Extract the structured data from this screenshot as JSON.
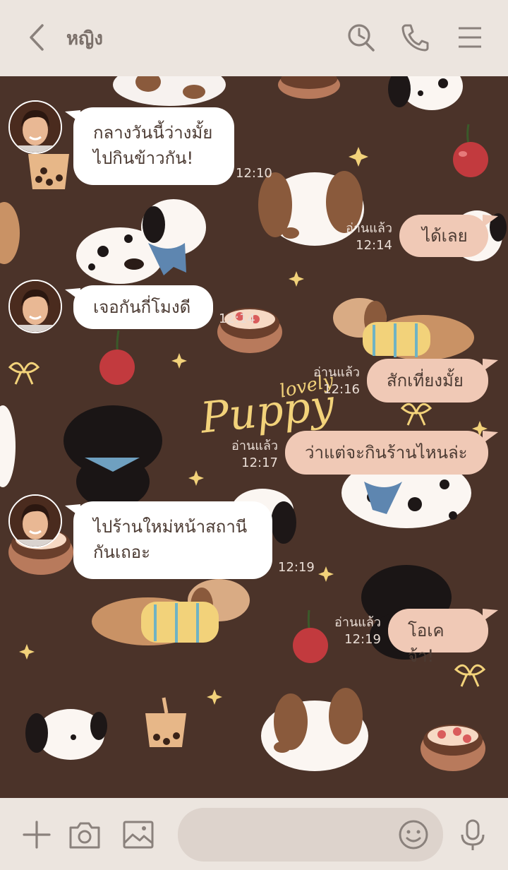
{
  "header": {
    "contact_name": "หญิง",
    "icons": [
      "back-arrow-icon",
      "clock-search-icon",
      "phone-icon",
      "menu-icon"
    ]
  },
  "messages": [
    {
      "side": "in",
      "text_lines": [
        "กลางวันนี้ว่างมั้ย",
        "ไปกินข้าวกัน!"
      ],
      "time": "12:10"
    },
    {
      "side": "out",
      "text": "ได้เลย",
      "read": "อ่านแล้ว",
      "time": "12:14"
    },
    {
      "side": "in",
      "text": "เจอกันกี่โมงดี",
      "time": "12:14"
    },
    {
      "side": "out",
      "text": "สักเที่ยงมั้ย",
      "read": "อ่านแล้ว",
      "time": "12:16"
    },
    {
      "side": "out",
      "text": "ว่าแต่จะกินร้านไหนล่ะ",
      "read": "อ่านแล้ว",
      "time": "12:17"
    },
    {
      "side": "in",
      "text_lines": [
        "ไปร้านใหม่หน้าสถานี",
        "กันเถอะ"
      ],
      "time": "12:19"
    },
    {
      "side": "out",
      "text": "โอเคจ้า!",
      "read": "อ่านแล้ว",
      "time": "12:19"
    }
  ],
  "background": {
    "script_title_small": "lovely",
    "script_title_big": "Puppy"
  },
  "footer": {
    "icons": [
      "plus-icon",
      "camera-icon",
      "image-icon",
      "emoji-icon",
      "microphone-icon"
    ],
    "input_placeholder": ""
  },
  "colors": {
    "header_bg": "#ece5df",
    "chat_bg": "#4b3329",
    "incoming_bubble": "#ffffff",
    "outgoing_bubble": "#f0c9b6",
    "icon_gray": "#8a817c"
  }
}
